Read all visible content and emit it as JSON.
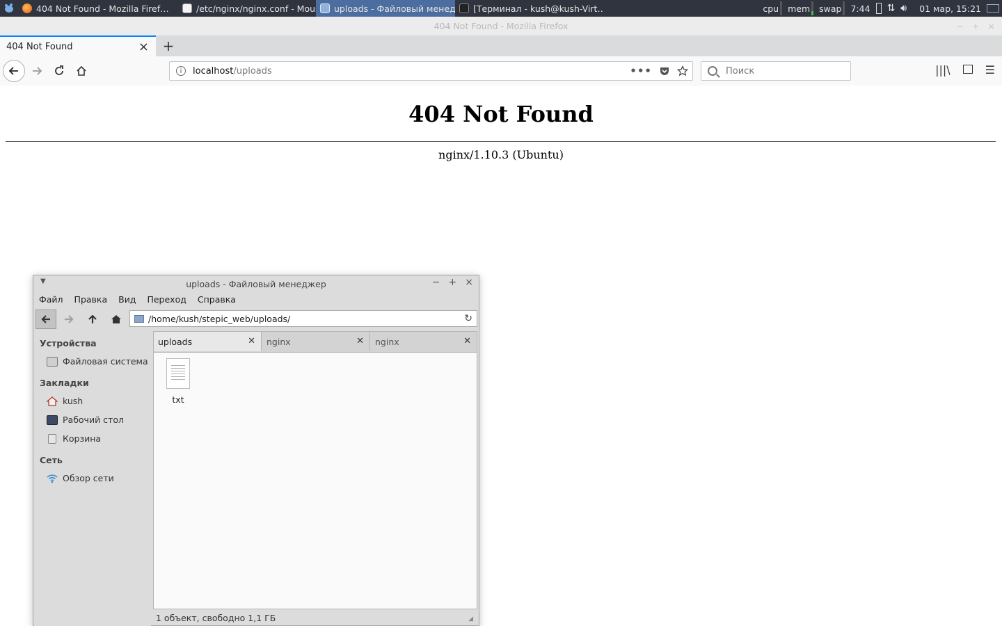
{
  "panel": {
    "tasks": [
      {
        "label": "404 Not Found - Mozilla Firef…",
        "icon": "firefox-icon",
        "active": false
      },
      {
        "label": "/etc/nginx/nginx.conf - Mous…",
        "icon": "text-editor-icon",
        "active": false
      },
      {
        "label": "uploads - Файловый менед…",
        "icon": "folder-icon",
        "active": true
      },
      {
        "label": "[Терминал - kush@kush-Virt…",
        "icon": "terminal-icon",
        "active": false
      }
    ],
    "monitors": {
      "cpu": "cpu",
      "mem": "mem",
      "swap": "swap"
    },
    "battery_time": "7:44",
    "clock": "01 мар, 15:21"
  },
  "firefox": {
    "window_title": "404 Not Found - Mozilla Firefox",
    "tab_title": "404 Not Found",
    "url_host": "localhost",
    "url_path": "/uploads",
    "search_placeholder": "Поиск",
    "page": {
      "heading": "404 Not Found",
      "server": "nginx/1.10.3 (Ubuntu)"
    }
  },
  "file_manager": {
    "title": "uploads - Файловый менеджер",
    "menu": [
      "Файл",
      "Правка",
      "Вид",
      "Переход",
      "Справка"
    ],
    "path": "/home/kush/stepic_web/uploads/",
    "sidebar": {
      "devices_header": "Устройства",
      "devices": [
        {
          "label": "Файловая система",
          "icon": "drive-icon"
        }
      ],
      "bookmarks_header": "Закладки",
      "bookmarks": [
        {
          "label": "kush",
          "icon": "home-icon"
        },
        {
          "label": "Рабочий стол",
          "icon": "desktop-icon"
        },
        {
          "label": "Корзина",
          "icon": "trash-icon"
        }
      ],
      "network_header": "Сеть",
      "network": [
        {
          "label": "Обзор сети",
          "icon": "wifi-icon"
        }
      ]
    },
    "tabs": [
      {
        "label": "uploads",
        "active": true
      },
      {
        "label": "nginx",
        "active": false
      },
      {
        "label": "nginx",
        "active": false
      }
    ],
    "files": [
      {
        "name": "txt",
        "icon": "text-file-icon"
      }
    ],
    "status": "1 объект, свободно 1,1 ГБ"
  }
}
